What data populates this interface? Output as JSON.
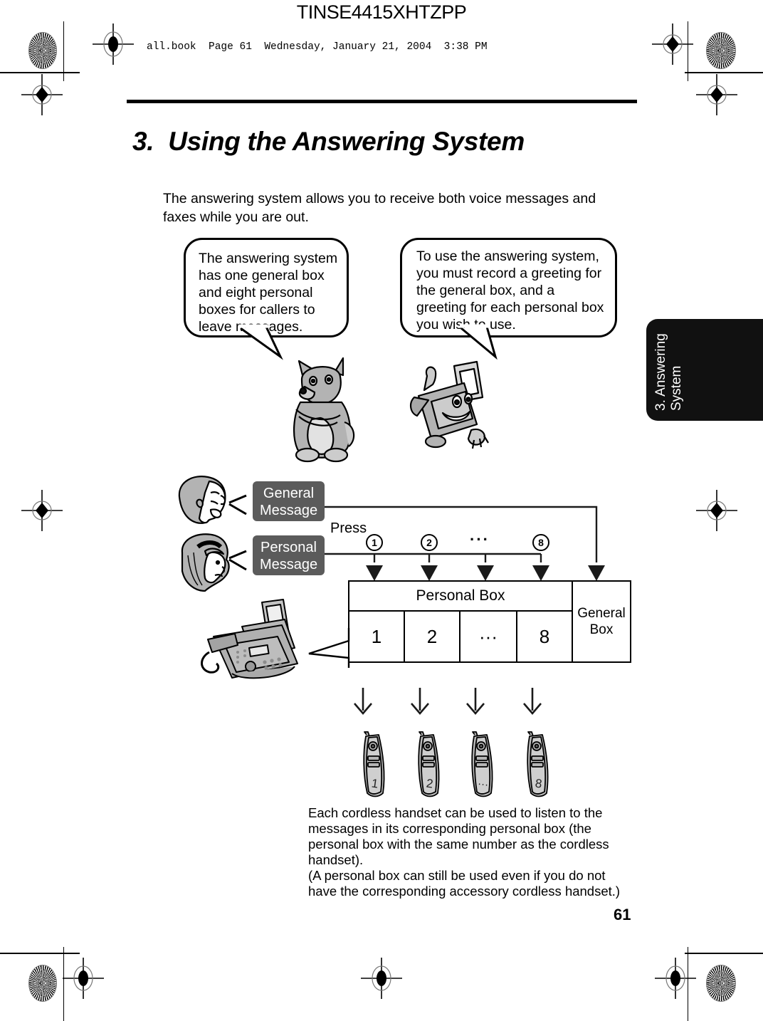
{
  "print_header": {
    "doc_code": "TINSE4415XHTZPP",
    "file_line": "all.book  Page 61  Wednesday, January 21, 2004  3:38 PM"
  },
  "chapter": {
    "number": "3.",
    "title": "3.  Using the Answering System",
    "intro": "The answering system allows you to receive both voice messages and faxes while you are out."
  },
  "side_tab": {
    "label": "3. Answering\nSystem",
    "background": "#111111",
    "text_color": "#ffffff"
  },
  "balloons": [
    {
      "id": "balloon-left",
      "text": "The answering system has one general box and eight personal boxes for callers to leave messages."
    },
    {
      "id": "balloon-right",
      "text": "To use the answering system, you must record a greeting for the general box, and a greeting for each personal box you wish to use."
    }
  ],
  "diagram": {
    "chips": [
      {
        "id": "general-message",
        "label": "General\nMessage",
        "color": "#5b5b5b"
      },
      {
        "id": "personal-message",
        "label": "Personal\nMessage",
        "color": "#5b5b5b"
      }
    ],
    "press_label": "Press",
    "press_keys": [
      "1",
      "2",
      "⋯",
      "8"
    ],
    "press_key_ellipsis": "···",
    "table": {
      "group_header": "Personal Box",
      "personal_cells": [
        "1",
        "2",
        "···",
        "8"
      ],
      "general_header": "General\nBox"
    },
    "handsets": [
      "1",
      "2",
      "···",
      "8"
    ]
  },
  "caption": "Each cordless handset can be used to listen to the messages in its corresponding personal box (the personal box with the same number as the cordless handset).\n(A personal box can still be used even if you do not have the corresponding accessory cordless handset.)",
  "page_number": "61",
  "icons": {
    "mascot_animal": "squirrel-mascot-icon",
    "mascot_fax": "fax-machine-mascot-icon",
    "head_male": "male-head-profile-icon",
    "head_female": "female-head-profile-icon",
    "fax_machine": "fax-machine-illustration-icon",
    "handset": "cordless-handset-icon",
    "registration": "registration-crosshair-icon",
    "star": "star-target-icon"
  }
}
